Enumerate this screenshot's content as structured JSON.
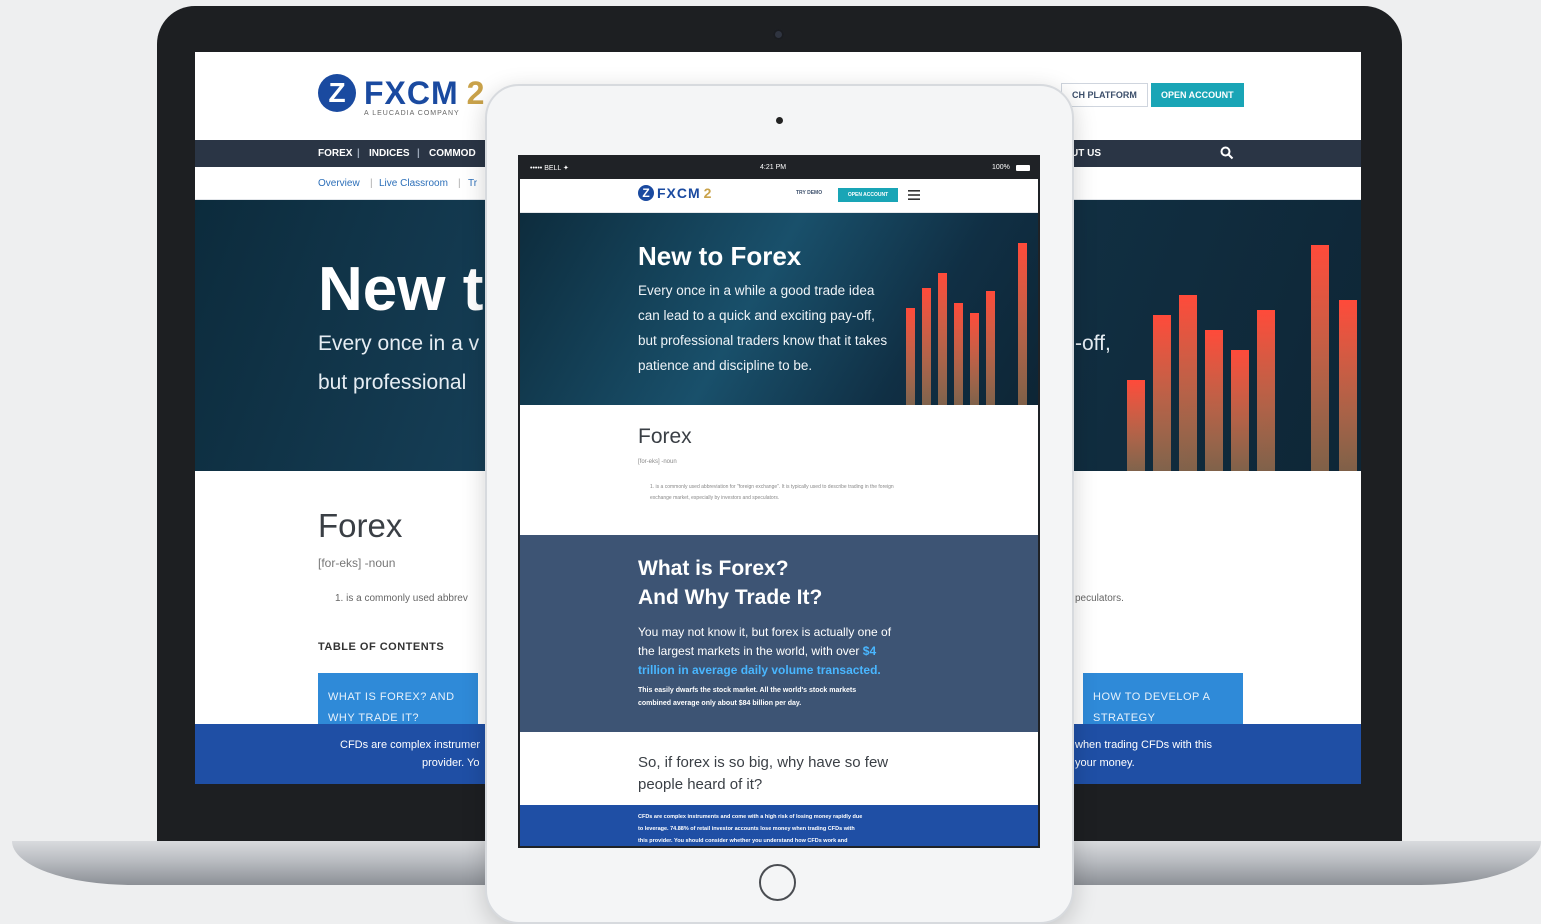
{
  "desktop": {
    "logo_word": "FXCM",
    "logo_tagline": "A LEUCADIA COMPANY",
    "logo_anniversary": "2",
    "header_buttons": [
      "CH PLATFORM",
      "OPEN ACCOUNT"
    ],
    "nav": [
      "FOREX",
      "INDICES",
      "COMMOD",
      "UT US"
    ],
    "subnav": [
      "Overview",
      "Live Classroom",
      "Tr"
    ],
    "hero_title": "New t",
    "hero_lines": [
      "Every once in a v",
      "but professional",
      "-off,"
    ],
    "section_title": "Forex",
    "pronunciation": "[for-eks] -noun",
    "definition_start": "1.  is a commonly used abbrev",
    "definition_end": "peculators.",
    "toc_label": "TABLE OF CONTENTS",
    "toc_cards": [
      {
        "line1": "WHAT IS FOREX? AND",
        "line2": "WHY TRADE IT?"
      },
      {
        "line1": "HOW TO DEVELOP A",
        "line2": "STRATEGY"
      }
    ],
    "risk_left": [
      "CFDs are complex instrumer",
      "provider. Yo"
    ],
    "risk_right": [
      "when trading CFDs with this",
      "your money."
    ]
  },
  "tablet": {
    "status_left": "••••• BELL ✦",
    "status_time": "4:21 PM",
    "status_right": "100%",
    "logo_word": "FXCM",
    "demo_link": "TRY DEMO",
    "cta": "OPEN ACCOUNT",
    "hero_title": "New to Forex",
    "hero_lines": [
      "Every once in a while a good trade idea",
      "can lead to a quick and exciting pay-off,",
      "but professional traders know that it takes",
      "patience and discipline to be."
    ],
    "section_title": "Forex",
    "pronunciation": "[for-eks] -noun",
    "definition": "1.  is a commonly used abbreviation for \"foreign exchange\". It is typically used to describe trading in the foreign exchange market, especially by investors and speculators.",
    "what_title_1": "What is Forex?",
    "what_title_2": "And Why Trade It?",
    "what_line_1": "You may not know it, but forex is actually one of",
    "what_line_2": "the largest markets in the world, with over",
    "what_link_1": "$4",
    "what_link_2": "trillion in average daily volume transacted.",
    "what_small_1": "This easily dwarfs the stock market. All the world's stock markets",
    "what_small_2": "combined average only about $84 billion per day.",
    "so_line_1": "So, if forex is so big, why have so few",
    "so_line_2": "people heard of it?",
    "risk_lines": [
      "CFDs are complex instruments and come with a high risk of losing money rapidly due",
      "to leverage. 74.88% of retail investor accounts lose money when trading CFDs with",
      "this provider. You should consider whether you understand how CFDs work and"
    ]
  },
  "colors": {
    "brand_blue": "#1a4aa0",
    "cta_teal": "#19a5b6",
    "nav_dark": "#2a3545",
    "risk_blue": "#1f4fa5",
    "section_slate": "#3d5474"
  },
  "icons": [
    "search-icon",
    "menu-icon",
    "camera-icon",
    "home-button-icon"
  ]
}
